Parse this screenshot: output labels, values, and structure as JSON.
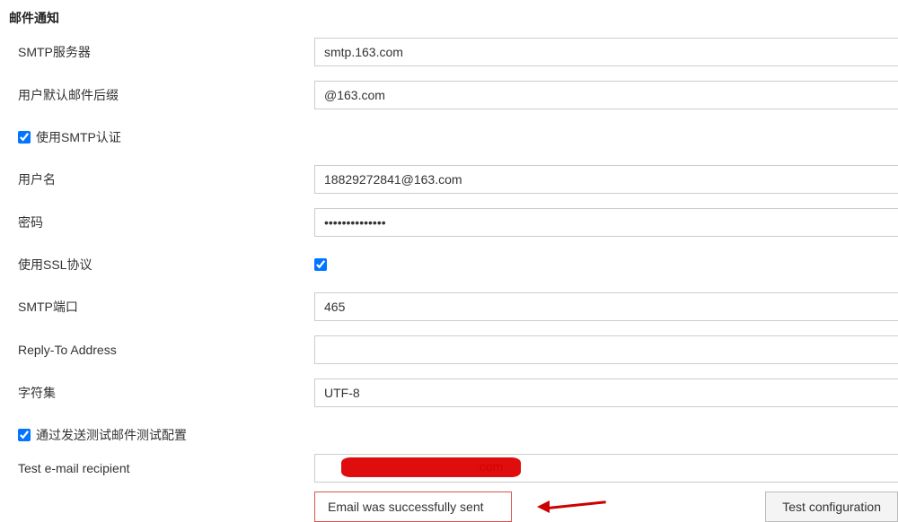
{
  "section": {
    "title": "邮件通知"
  },
  "fields": {
    "smtp_server": {
      "label": "SMTP服务器",
      "value": "smtp.163.com"
    },
    "email_suffix": {
      "label": "用户默认邮件后缀",
      "value": "@163.com"
    },
    "use_smtp_auth": {
      "label": "使用SMTP认证"
    },
    "username": {
      "label": "用户名",
      "value": "18829272841@163.com"
    },
    "password": {
      "label": "密码",
      "value": "••••••••••••••"
    },
    "use_ssl": {
      "label": "使用SSL协议"
    },
    "smtp_port": {
      "label": "SMTP端口",
      "value": "465"
    },
    "reply_to": {
      "label": "Reply-To Address",
      "value": ""
    },
    "charset": {
      "label": "字符集",
      "value": "UTF-8"
    },
    "test_send": {
      "label": "通过发送测试邮件测试配置"
    },
    "test_recipient": {
      "label": "Test e-mail recipient",
      "suffix": ".com"
    }
  },
  "status": {
    "message": "Email was successfully sent"
  },
  "buttons": {
    "test_config": "Test configuration"
  }
}
